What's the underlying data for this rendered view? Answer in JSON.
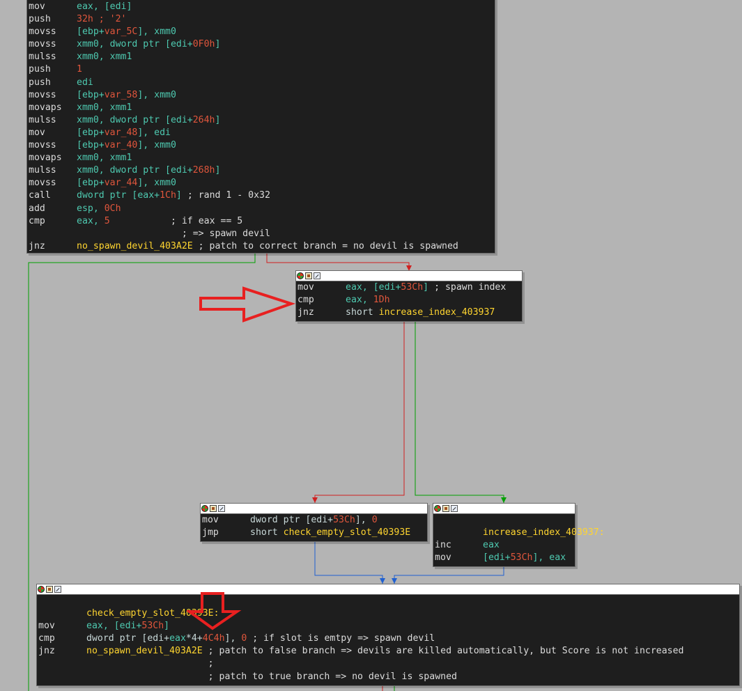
{
  "colors": {
    "background": "#b4b4b4",
    "node_bg": "#1e1e1e",
    "register": "#4ec9b0",
    "number": "#e0563c",
    "label": "#ffd530",
    "edge_true": "#00a000",
    "edge_false": "#d02020",
    "edge_uncond": "#2060d0",
    "annotation_arrow": "#e82020"
  },
  "icons": [
    "color-picker-icon",
    "graph-icon",
    "xref-icon"
  ],
  "blocks": {
    "top": {
      "lines": [
        {
          "mn": "mov",
          "ops": [
            {
              "t": "eax, [edi]",
              "c": "reg"
            }
          ]
        },
        {
          "mn": "push",
          "ops": [
            {
              "t": "32h",
              "c": "num"
            },
            {
              "t": " ; '2'",
              "c": "num"
            }
          ]
        },
        {
          "mn": "movss",
          "ops": [
            {
              "t": "[ebp+",
              "c": "reg"
            },
            {
              "t": "var_5C",
              "c": "num"
            },
            {
              "t": "], xmm0",
              "c": "reg"
            }
          ]
        },
        {
          "mn": "movss",
          "ops": [
            {
              "t": "xmm0, dword ptr [edi+",
              "c": "reg"
            },
            {
              "t": "0F0h",
              "c": "num"
            },
            {
              "t": "]",
              "c": "reg"
            }
          ]
        },
        {
          "mn": "mulss",
          "ops": [
            {
              "t": "xmm0, xmm1",
              "c": "reg"
            }
          ]
        },
        {
          "mn": "push",
          "ops": [
            {
              "t": "1",
              "c": "num"
            }
          ]
        },
        {
          "mn": "push",
          "ops": [
            {
              "t": "edi",
              "c": "reg"
            }
          ]
        },
        {
          "mn": "movss",
          "ops": [
            {
              "t": "[ebp+",
              "c": "reg"
            },
            {
              "t": "var_58",
              "c": "num"
            },
            {
              "t": "], xmm0",
              "c": "reg"
            }
          ]
        },
        {
          "mn": "movaps",
          "ops": [
            {
              "t": "xmm0, xmm1",
              "c": "reg"
            }
          ]
        },
        {
          "mn": "mulss",
          "ops": [
            {
              "t": "xmm0, dword ptr [edi+",
              "c": "reg"
            },
            {
              "t": "264h",
              "c": "num"
            },
            {
              "t": "]",
              "c": "reg"
            }
          ]
        },
        {
          "mn": "mov",
          "ops": [
            {
              "t": "[ebp+",
              "c": "reg"
            },
            {
              "t": "var_48",
              "c": "num"
            },
            {
              "t": "], edi",
              "c": "reg"
            }
          ]
        },
        {
          "mn": "movss",
          "ops": [
            {
              "t": "[ebp+",
              "c": "reg"
            },
            {
              "t": "var_40",
              "c": "num"
            },
            {
              "t": "], xmm0",
              "c": "reg"
            }
          ]
        },
        {
          "mn": "movaps",
          "ops": [
            {
              "t": "xmm0, xmm1",
              "c": "reg"
            }
          ]
        },
        {
          "mn": "mulss",
          "ops": [
            {
              "t": "xmm0, dword ptr [edi+",
              "c": "reg"
            },
            {
              "t": "268h",
              "c": "num"
            },
            {
              "t": "]",
              "c": "reg"
            }
          ]
        },
        {
          "mn": "movss",
          "ops": [
            {
              "t": "[ebp+",
              "c": "reg"
            },
            {
              "t": "var_44",
              "c": "num"
            },
            {
              "t": "], xmm0",
              "c": "reg"
            }
          ]
        },
        {
          "mn": "call",
          "ops": [
            {
              "t": "dword ptr [eax+",
              "c": "reg"
            },
            {
              "t": "1Ch",
              "c": "num"
            },
            {
              "t": "] ",
              "c": "reg"
            },
            {
              "t": "; rand 1 - 0x32",
              "c": "com"
            }
          ]
        },
        {
          "mn": "add",
          "ops": [
            {
              "t": "esp, ",
              "c": "reg"
            },
            {
              "t": "0Ch",
              "c": "num"
            }
          ]
        },
        {
          "mn": "cmp",
          "ops": [
            {
              "t": "eax, ",
              "c": "reg"
            },
            {
              "t": "5",
              "c": "num"
            },
            {
              "t": "           ; if eax == 5",
              "c": "com"
            }
          ]
        },
        {
          "mn": "",
          "ops": [
            {
              "t": "                   ; => spawn devil",
              "c": "com"
            }
          ]
        },
        {
          "mn": "jnz",
          "ops": [
            {
              "t": "no_spawn_devil_403A2E",
              "c": "lab"
            },
            {
              "t": " ; patch to correct branch = no devil is spawned",
              "c": "com"
            }
          ]
        }
      ]
    },
    "spawn_index": {
      "lines": [
        {
          "mn": "mov",
          "ops": [
            {
              "t": "eax, [edi+",
              "c": "reg"
            },
            {
              "t": "53Ch",
              "c": "num"
            },
            {
              "t": "] ",
              "c": "reg"
            },
            {
              "t": "; spawn index",
              "c": "com"
            }
          ]
        },
        {
          "mn": "cmp",
          "ops": [
            {
              "t": "eax, ",
              "c": "reg"
            },
            {
              "t": "1Dh",
              "c": "num"
            }
          ]
        },
        {
          "mn": "jnz",
          "ops": [
            {
              "t": "short ",
              "c": "plain"
            },
            {
              "t": "increase_index_403937",
              "c": "lab"
            }
          ]
        }
      ]
    },
    "reset_index": {
      "lines": [
        {
          "mn": "mov",
          "ops": [
            {
              "t": "dword ptr [edi+",
              "c": "plain"
            },
            {
              "t": "53Ch",
              "c": "num"
            },
            {
              "t": "], ",
              "c": "plain"
            },
            {
              "t": "0",
              "c": "num"
            }
          ]
        },
        {
          "mn": "jmp",
          "ops": [
            {
              "t": "short ",
              "c": "plain"
            },
            {
              "t": "check_empty_slot_40393E",
              "c": "lab"
            }
          ]
        }
      ]
    },
    "increase_index": {
      "lines": [
        {
          "mn": "",
          "ops": []
        },
        {
          "mn": "",
          "ops": [
            {
              "t": "increase_index_403937:",
              "c": "lab"
            }
          ]
        },
        {
          "mn": "inc",
          "ops": [
            {
              "t": "eax",
              "c": "reg"
            }
          ]
        },
        {
          "mn": "mov",
          "ops": [
            {
              "t": "[edi+",
              "c": "reg"
            },
            {
              "t": "53Ch",
              "c": "num"
            },
            {
              "t": "], eax",
              "c": "reg"
            }
          ]
        }
      ]
    },
    "check_slot": {
      "lines": [
        {
          "mn": "",
          "ops": []
        },
        {
          "mn": "",
          "ops": [
            {
              "t": "check_empty_slot_40393E:",
              "c": "lab"
            }
          ]
        },
        {
          "mn": "mov",
          "ops": [
            {
              "t": "eax, [edi+",
              "c": "reg"
            },
            {
              "t": "53Ch",
              "c": "num"
            },
            {
              "t": "]",
              "c": "reg"
            }
          ]
        },
        {
          "mn": "cmp",
          "ops": [
            {
              "t": "dword ptr [edi+",
              "c": "plain"
            },
            {
              "t": "eax",
              "c": "reg"
            },
            {
              "t": "*4+",
              "c": "plain"
            },
            {
              "t": "4C4h",
              "c": "num"
            },
            {
              "t": "], ",
              "c": "plain"
            },
            {
              "t": "0",
              "c": "num"
            },
            {
              "t": " ; if slot is emtpy => spawn devil",
              "c": "com"
            }
          ]
        },
        {
          "mn": "jnz",
          "ops": [
            {
              "t": "no_spawn_devil_403A2E",
              "c": "lab"
            },
            {
              "t": " ; patch to false branch => devils are killed automatically, but Score is not increased",
              "c": "com"
            }
          ]
        },
        {
          "mn": "",
          "ops": [
            {
              "t": "                      ;",
              "c": "com"
            }
          ]
        },
        {
          "mn": "",
          "ops": [
            {
              "t": "                      ; patch to true branch => no devil is spawned",
              "c": "com"
            }
          ]
        }
      ]
    }
  }
}
